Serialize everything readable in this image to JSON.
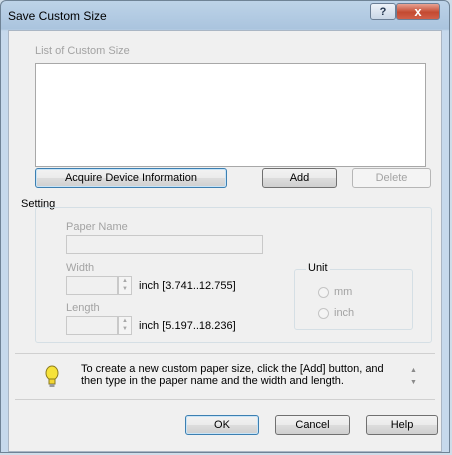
{
  "window": {
    "title": "Save Custom Size",
    "help_glyph": "?",
    "close_glyph": "x"
  },
  "list": {
    "label": "List of Custom Size",
    "items": []
  },
  "buttons": {
    "acquire": "Acquire Device Information",
    "add": "Add",
    "delete": "Delete",
    "ok": "OK",
    "cancel": "Cancel",
    "help": "Help"
  },
  "setting": {
    "label": "Setting",
    "paper_name_label": "Paper Name",
    "paper_name_value": "",
    "width_label": "Width",
    "width_value": "",
    "width_range": "inch [3.741..12.755]",
    "length_label": "Length",
    "length_value": "",
    "length_range": "inch [5.197..18.236]",
    "unit": {
      "label": "Unit",
      "options": [
        "mm",
        "inch"
      ]
    }
  },
  "info": {
    "icon": "lightbulb-icon",
    "line1": "To create a new custom paper size, click the [Add] button, and",
    "line2": "then type in the paper name and the width and length."
  },
  "colors": {
    "titlebar": "#aac4de",
    "close_button": "#c44a31",
    "focus_border": "#3c7fb1",
    "bulb": "#f6e23a"
  }
}
